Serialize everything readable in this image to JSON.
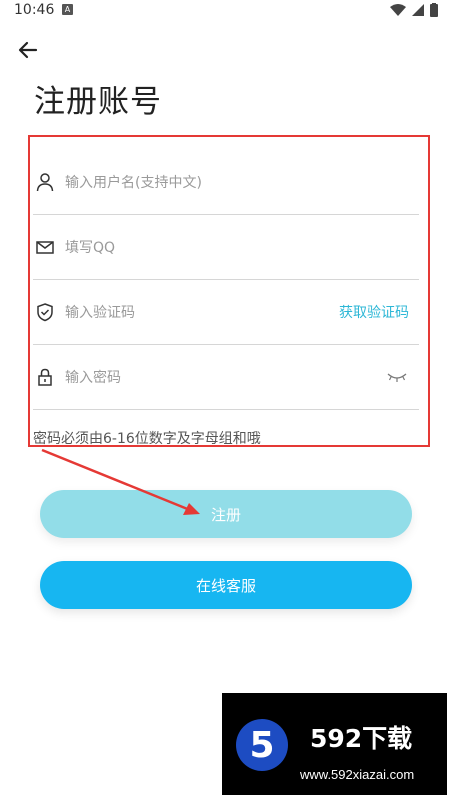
{
  "status": {
    "time": "10:46"
  },
  "header": {
    "title": "注册账号"
  },
  "form": {
    "username_placeholder": "输入用户名(支持中文)",
    "qq_placeholder": "填写QQ",
    "code_placeholder": "输入验证码",
    "get_code_label": "获取验证码",
    "password_placeholder": "输入密码",
    "password_hint": "密码必须由6-16位数字及字母组和哦"
  },
  "buttons": {
    "register": "注册",
    "customer_service": "在线客服"
  },
  "watermark": {
    "brand": "592下载",
    "url": "www.592xiazai.com"
  },
  "colors": {
    "accent": "#2db7d6",
    "register_bg": "#92dde8",
    "service_bg": "#17b6f1",
    "annotation": "#e53935"
  }
}
